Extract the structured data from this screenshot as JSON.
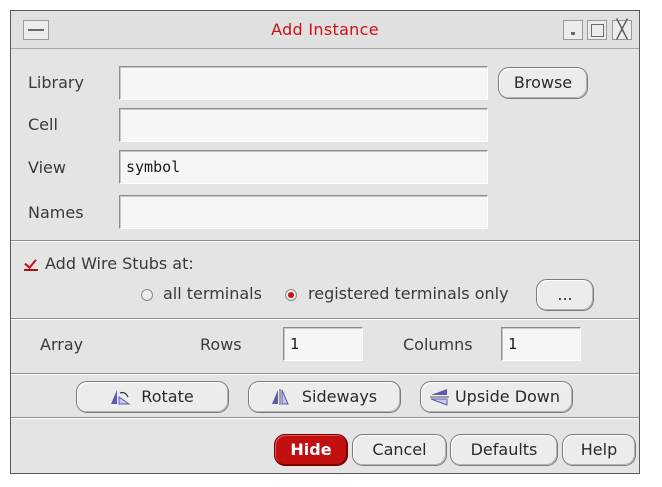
{
  "window": {
    "title": "Add Instance"
  },
  "form": {
    "library": {
      "label": "Library",
      "value": ""
    },
    "cell": {
      "label": "Cell",
      "value": ""
    },
    "view": {
      "label": "View",
      "value": "symbol"
    },
    "names": {
      "label": "Names",
      "value": ""
    },
    "browse_label": "Browse"
  },
  "wire_stubs": {
    "label": "Add Wire Stubs at:",
    "checked": true,
    "option_all": "all terminals",
    "option_registered": "registered terminals only",
    "selected": "registered terminals only",
    "more_label": "..."
  },
  "array": {
    "label": "Array",
    "rows_label": "Rows",
    "rows_value": "1",
    "columns_label": "Columns",
    "columns_value": "1"
  },
  "transform": {
    "rotate_label": "Rotate",
    "sideways_label": "Sideways",
    "upside_down_label": "Upside Down"
  },
  "footer": {
    "hide_label": "Hide",
    "cancel_label": "Cancel",
    "defaults_label": "Defaults",
    "help_label": "Help"
  },
  "colors": {
    "title": "#cc1111",
    "hide_button": "#c21010",
    "window_bg": "#e4e4e4"
  },
  "icons": {
    "window_menu": "window-menu-icon",
    "minimize": "minimize-icon",
    "maximize": "maximize-icon",
    "close": "close-icon",
    "rotate": "rotate-icon",
    "sideways": "sideways-icon",
    "upside_down": "upside-down-icon"
  }
}
